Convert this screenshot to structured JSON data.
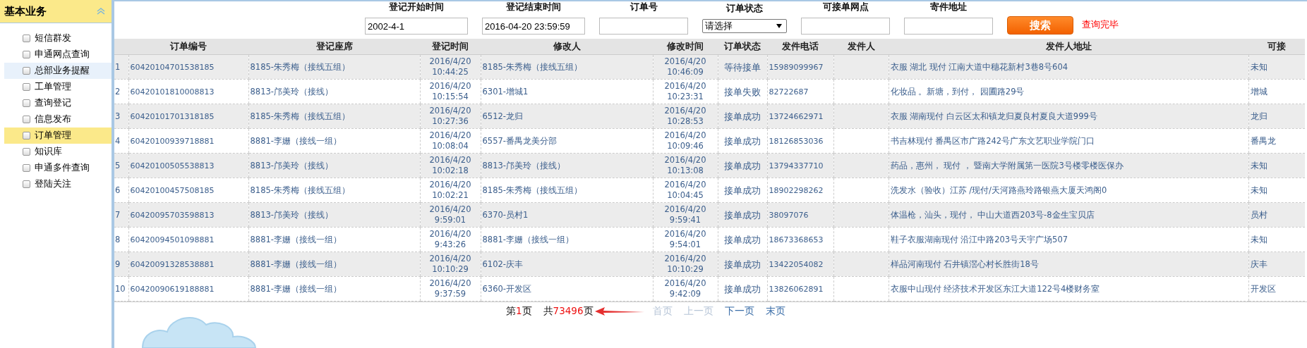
{
  "sidebar": {
    "title": "基本业务",
    "items": [
      {
        "label": "短信群发",
        "selected": false,
        "highlighted": false
      },
      {
        "label": "申通网点查询",
        "selected": false,
        "highlighted": false
      },
      {
        "label": "总部业务提醒",
        "selected": false,
        "highlighted": true
      },
      {
        "label": "工单管理",
        "selected": false,
        "highlighted": false
      },
      {
        "label": "查询登记",
        "selected": false,
        "highlighted": false
      },
      {
        "label": "信息发布",
        "selected": false,
        "highlighted": false
      },
      {
        "label": "订单管理",
        "selected": true,
        "highlighted": false
      },
      {
        "label": "知识库",
        "selected": false,
        "highlighted": false
      },
      {
        "label": "申通多件查询",
        "selected": false,
        "highlighted": false
      },
      {
        "label": "登陆关注",
        "selected": false,
        "highlighted": false
      }
    ]
  },
  "search": {
    "fields": [
      {
        "kind": "input",
        "label": "登记开始时间",
        "value": "2002-4-1"
      },
      {
        "kind": "input",
        "label": "登记结束时间",
        "value": "2016-04-20 23:59:59"
      },
      {
        "kind": "input",
        "label": "订单号"
      },
      {
        "kind": "select",
        "label": "订单状态",
        "value": "请选择"
      },
      {
        "kind": "input",
        "label": "可接单网点"
      },
      {
        "kind": "input",
        "label": "寄件地址"
      }
    ],
    "button": "搜索",
    "status": "查询完毕"
  },
  "table": {
    "columns": [
      "",
      "订单编号",
      "登记座席",
      "登记时间",
      "修改人",
      "修改时间",
      "订单状态",
      "发件电话",
      "发件人",
      "发件人地址",
      "可接"
    ],
    "rows": [
      [
        "1",
        "60420104701538185",
        "8185-朱秀梅（接线五组）",
        "2016/4/20 10:44:25",
        "8185-朱秀梅（接线五组）",
        "2016/4/20 10:46:09",
        "等待接单",
        "15989099967",
        "",
        "衣服 湖北 现付 江南大道中穗花新村3巷8号604",
        "未知"
      ],
      [
        "2",
        "60420101810008813",
        "8813-邝美玲（接线）",
        "2016/4/20 10:15:54",
        "6301-增城1",
        "2016/4/20 10:23:31",
        "接单失败",
        "82722687",
        "",
        "化妆品 。新塘，到付， 园圃路29号",
        "增城"
      ],
      [
        "3",
        "60420101701318185",
        "8185-朱秀梅（接线五组）",
        "2016/4/20 10:27:36",
        "6512-龙归",
        "2016/4/20 10:28:53",
        "接单成功",
        "13724662971",
        "",
        "衣服 湖南现付 白云区太和镇龙归夏良村夏良大道999号",
        "龙归"
      ],
      [
        "4",
        "60420100939718881",
        "8881-李姗（接线一组）",
        "2016/4/20 10:08:04",
        "6557-番禺龙美分部",
        "2016/4/20 10:09:46",
        "接单成功",
        "18126853036",
        "",
        "书吉林现付 番禺区市广路242号广东文艺职业学院门口",
        "番禺龙"
      ],
      [
        "5",
        "60420100505538813",
        "8813-邝美玲（接线）",
        "2016/4/20 10:02:18",
        "8813-邝美玲（接线）",
        "2016/4/20 10:13:08",
        "接单成功",
        "13794337710",
        "",
        "药品，惠州， 现付 ， 暨南大学附属第一医院3号楼零楼医保办",
        "未知"
      ],
      [
        "6",
        "60420100457508185",
        "8185-朱秀梅（接线五组）",
        "2016/4/20 10:02:21",
        "8185-朱秀梅（接线五组）",
        "2016/4/20 10:04:45",
        "接单成功",
        "18902298262",
        "",
        "洗发水（验收）江苏 /现付/天河路燕玲路银燕大厦天鸿阁0",
        "未知"
      ],
      [
        "7",
        "60420095703598813",
        "8813-邝美玲（接线）",
        "2016/4/20 9:59:01",
        "6370-员村1",
        "2016/4/20 9:59:41",
        "接单成功",
        "38097076",
        "",
        "体温枪，汕头，现付， 中山大道西203号-8金生宝贝店",
        "员村"
      ],
      [
        "8",
        "60420094501098881",
        "8881-李姗（接线一组）",
        "2016/4/20 9:43:26",
        "8881-李姗（接线一组）",
        "2016/4/20 9:54:01",
        "接单成功",
        "18673368653",
        "",
        "鞋子衣服湖南现付 沿江中路203号天宇广场507",
        "未知"
      ],
      [
        "9",
        "60420091328538881",
        "8881-李姗（接线一组）",
        "2016/4/20 10:10:29",
        "6102-庆丰",
        "2016/4/20 10:10:29",
        "接单成功",
        "13422054082",
        "",
        "样品河南现付 石井镇滘心村长胜街18号",
        "庆丰"
      ],
      [
        "10",
        "60420090619188881",
        "8881-李姗（接线一组）",
        "2016/4/20 9:37:59",
        "6360-开发区",
        "2016/4/20 9:42:09",
        "接单成功",
        "13826062891",
        "",
        "衣服中山现付 经济技术开发区东江大道122号4楼财务室",
        "开发区"
      ]
    ]
  },
  "pagination": {
    "current": {
      "before": "第",
      "number": "1",
      "after": "页"
    },
    "total": {
      "before": "共",
      "number": "73496",
      "after": "页"
    },
    "links": [
      {
        "label": "首页",
        "disabled": true
      },
      {
        "label": "上一页",
        "disabled": true
      },
      {
        "label": "下一页",
        "disabled": false
      },
      {
        "label": "末页",
        "disabled": false
      }
    ]
  }
}
